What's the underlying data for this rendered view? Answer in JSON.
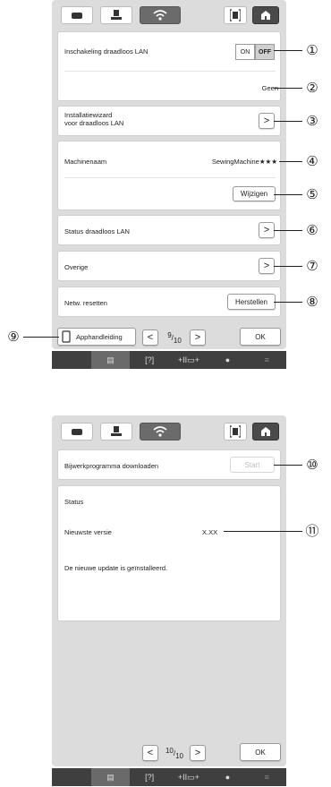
{
  "colors": {
    "panel": "#dcdcdc",
    "status_bar": "#3f3f3f",
    "active_tab": "#6b6b6b"
  },
  "screen1": {
    "rows": {
      "wlan": {
        "label": "Inschakeling draadloos LAN",
        "on": "ON",
        "off": "OFF"
      },
      "network": {
        "value": "Geen"
      },
      "wizard": {
        "label_line1": "Installatiewizard",
        "label_line2": "voor draadloos LAN"
      },
      "machine": {
        "label": "Machinenaam",
        "value": "SewingMachine★★★",
        "change_button": "Wijzigen"
      },
      "status": {
        "label": "Status draadloos LAN"
      },
      "other": {
        "label": "Overige"
      },
      "reset": {
        "label": "Netw. resetten",
        "button": "Herstellen"
      }
    },
    "footer": {
      "app_button": "Apphandleiding",
      "page_current": "9",
      "page_total": "10",
      "ok": "OK"
    }
  },
  "screen2": {
    "download": {
      "label": "Bijwerkprogramma downloaden",
      "button": "Start"
    },
    "status": {
      "heading": "Status",
      "latest_label": "Nieuwste versie",
      "latest_value": "X.XX",
      "message": "De nieuwe update is geïnstalleerd."
    },
    "footer": {
      "page_current": "10",
      "page_total": "10",
      "ok": "OK"
    }
  },
  "callouts": [
    "①",
    "②",
    "③",
    "④",
    "⑤",
    "⑥",
    "⑦",
    "⑧",
    "⑨",
    "⑩",
    "⑪"
  ],
  "icons": {
    "arrow_right": ">",
    "arrow_left": "<",
    "statusbar_page": "▤",
    "statusbar_help": "[?]",
    "statusbar_needle": "+II▭+",
    "statusbar_clock": "●",
    "statusbar_wifi": "≡"
  }
}
